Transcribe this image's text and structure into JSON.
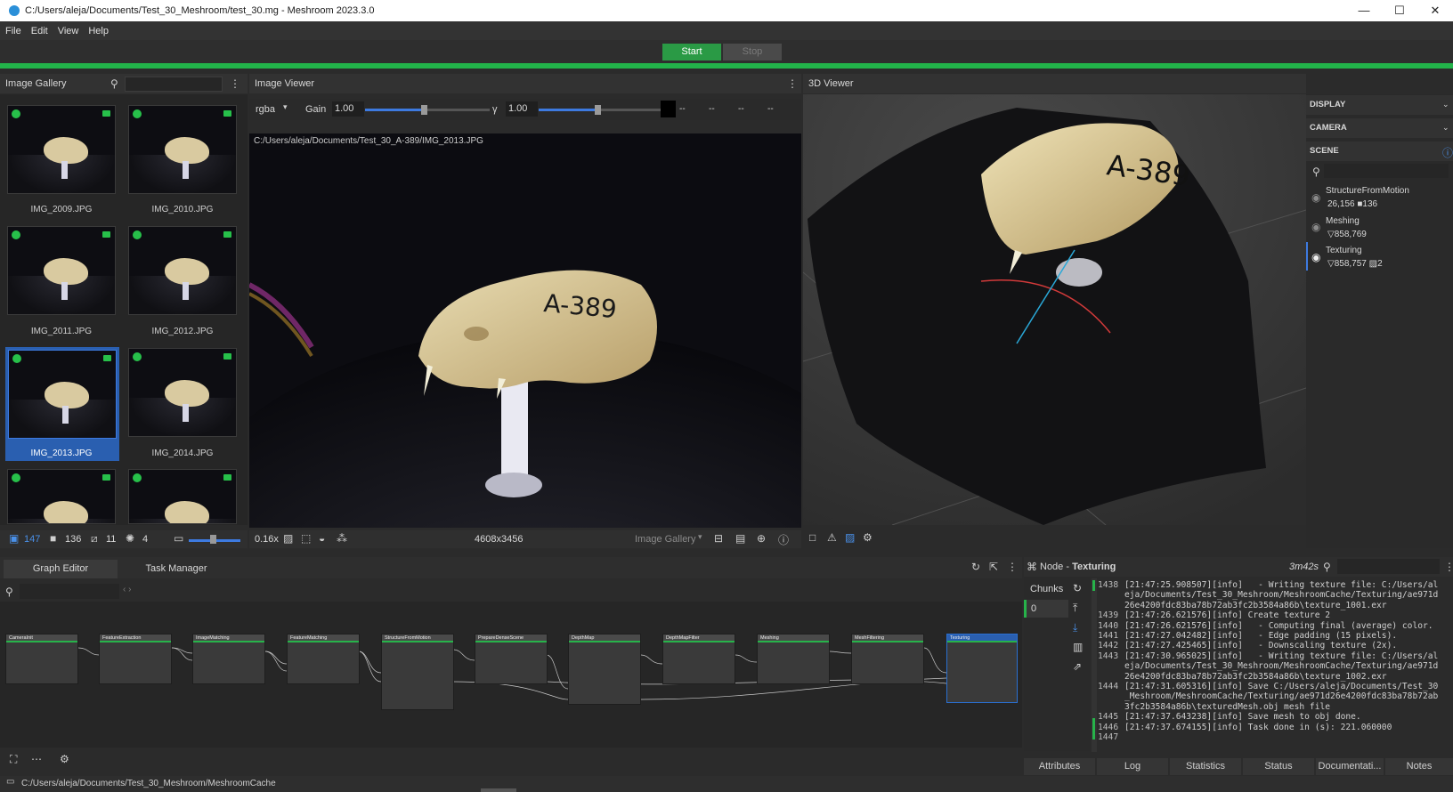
{
  "window": {
    "title": "C:/Users/aleja/Documents/Test_30_Meshroom/test_30.mg - Meshroom 2023.3.0",
    "controls": [
      "—",
      "☐",
      "✕"
    ]
  },
  "menu": [
    "File",
    "Edit",
    "View",
    "Help"
  ],
  "run": {
    "start_label": "Start",
    "stop_label": "Stop",
    "progress": 1.0
  },
  "gallery": {
    "title": "Image Gallery",
    "search_placeholder": "",
    "images": [
      "IMG_2009.JPG",
      "IMG_2010.JPG",
      "IMG_2011.JPG",
      "IMG_2012.JPG",
      "IMG_2013.JPG",
      "IMG_2014.JPG",
      "",
      ""
    ],
    "selected": "IMG_2013.JPG",
    "counts": {
      "images": "147",
      "cameras": "136",
      "no_intrinsics": "11",
      "rigs": "4"
    }
  },
  "image_viewer": {
    "title": "Image Viewer",
    "channel": "rgba",
    "gain_label": "Gain",
    "gain_value": "1.00",
    "gamma_label": "γ",
    "gamma_value": "1.00",
    "pixel_values": [
      "--",
      "--",
      "--",
      "--"
    ],
    "path": "C:/Users/aleja/Documents/Test_30_A-389/IMG_2013.JPG",
    "zoom": "0.16x",
    "resolution": "4608x3456",
    "source": "Image Gallery",
    "label_text": "A-389"
  },
  "viewer3d": {
    "title": "3D Viewer",
    "sections": [
      "DISPLAY",
      "CAMERA",
      "SCENE"
    ],
    "scene_items": [
      {
        "name": "StructureFromMotion",
        "stats": "26,156  ■136"
      },
      {
        "name": "Meshing",
        "stats": "▽858,769"
      },
      {
        "name": "Texturing",
        "stats": "▽858,757  ▨2"
      }
    ],
    "label_text": "A-389"
  },
  "graph": {
    "tabs": [
      "Graph Editor",
      "Task Manager"
    ],
    "nodes": [
      {
        "name": "CameraInit"
      },
      {
        "name": "FeatureExtraction"
      },
      {
        "name": "ImageMatching"
      },
      {
        "name": "FeatureMatching"
      },
      {
        "name": "StructureFromMotion"
      },
      {
        "name": "PrepareDenseScene"
      },
      {
        "name": "DepthMap"
      },
      {
        "name": "DepthMapFilter"
      },
      {
        "name": "Meshing"
      },
      {
        "name": "MeshFiltering"
      },
      {
        "name": "Texturing"
      }
    ]
  },
  "node_panel": {
    "title_prefix": "Node - ",
    "title_node": "Texturing",
    "elapsed": "3m42s",
    "chunks_label": "Chunks",
    "chunk_index": "0",
    "log_lines": [
      {
        "n": "1438",
        "t": "[21:47:25.908507][info]   - Writing texture file: C:/Users/al"
      },
      {
        "n": "",
        "t": "eja/Documents/Test_30_Meshroom/MeshroomCache/Texturing/ae971d"
      },
      {
        "n": "",
        "t": "26e4200fdc83ba78b72ab3fc2b3584a86b\\texture_1001.exr"
      },
      {
        "n": "1439",
        "t": "[21:47:26.621576][info] Create texture 2"
      },
      {
        "n": "1440",
        "t": "[21:47:26.621576][info]   - Computing final (average) color."
      },
      {
        "n": "1441",
        "t": "[21:47:27.042482][info]   - Edge padding (15 pixels)."
      },
      {
        "n": "1442",
        "t": "[21:47:27.425465][info]   - Downscaling texture (2x)."
      },
      {
        "n": "1443",
        "t": "[21:47:30.965025][info]   - Writing texture file: C:/Users/al"
      },
      {
        "n": "",
        "t": "eja/Documents/Test_30_Meshroom/MeshroomCache/Texturing/ae971d"
      },
      {
        "n": "",
        "t": "26e4200fdc83ba78b72ab3fc2b3584a86b\\texture_1002.exr"
      },
      {
        "n": "1444",
        "t": "[21:47:31.605316][info] Save C:/Users/aleja/Documents/Test_30"
      },
      {
        "n": "",
        "t": "_Meshroom/MeshroomCache/Texturing/ae971d26e4200fdc83ba78b72ab"
      },
      {
        "n": "",
        "t": "3fc2b3584a86b\\texturedMesh.obj mesh file"
      },
      {
        "n": "1445",
        "t": "[21:47:37.643238][info] Save mesh to obj done."
      },
      {
        "n": "1446",
        "t": "[21:47:37.674155][info] Task done in (s): 221.060000"
      },
      {
        "n": "1447",
        "t": ""
      }
    ],
    "tabs": [
      "Attributes",
      "Log",
      "Statistics",
      "Status",
      "Documentati...",
      "Notes"
    ]
  },
  "statusbar": {
    "path": "C:/Users/aleja/Documents/Test_30_Meshroom/MeshroomCache"
  }
}
